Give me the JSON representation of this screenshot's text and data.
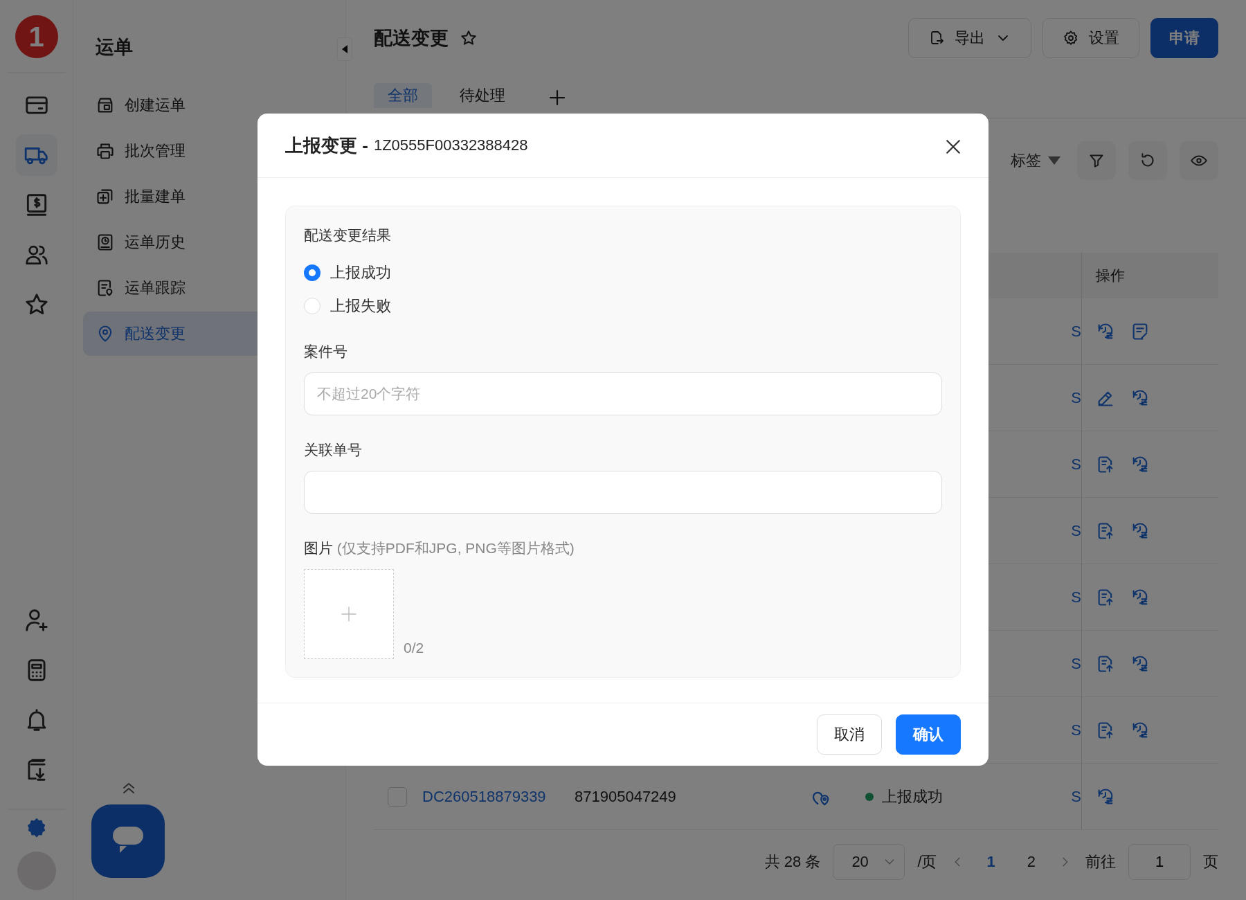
{
  "rail": {
    "logo": "1",
    "top": [
      {
        "kind": "card",
        "selected": false
      },
      {
        "kind": "truck",
        "selected": true
      },
      {
        "kind": "dollar-book",
        "selected": false
      },
      {
        "kind": "people",
        "selected": false
      },
      {
        "kind": "star",
        "selected": false
      }
    ],
    "bottom": [
      {
        "kind": "user-plus",
        "selected": false
      },
      {
        "kind": "calculator",
        "selected": false
      },
      {
        "kind": "bell",
        "selected": false
      },
      {
        "kind": "book-download",
        "selected": false
      }
    ]
  },
  "nav": {
    "title": "运单",
    "items": [
      {
        "label": "创建运单",
        "kind": "box",
        "selected": false
      },
      {
        "label": "批次管理",
        "kind": "printer",
        "selected": false
      },
      {
        "label": "批量建单",
        "kind": "copy-plus",
        "selected": false
      },
      {
        "label": "运单历史",
        "kind": "clock-document",
        "selected": false
      },
      {
        "label": "运单跟踪",
        "kind": "document-pin",
        "selected": false
      },
      {
        "label": "配送变更",
        "kind": "location-pin",
        "selected": true
      }
    ]
  },
  "header": {
    "title": "配送变更",
    "export": "导出",
    "settings": "设置",
    "apply": "申请"
  },
  "tabs": [
    {
      "label": "全部",
      "selected": true
    },
    {
      "label": "待处理",
      "selected": false
    }
  ],
  "toolbar": {
    "tag_filter": "标签"
  },
  "table": {
    "columns": {
      "actions": "操作"
    },
    "rows": [
      {
        "column_6": "S",
        "actions": [
          {
            "kind": "clock-list"
          },
          {
            "kind": "document-pen"
          }
        ]
      },
      {
        "column_6": "S",
        "actions": [
          {
            "kind": "pencil"
          },
          {
            "kind": "clock-list"
          }
        ]
      },
      {
        "column_6": "S",
        "actions": [
          {
            "kind": "document-arrow"
          },
          {
            "kind": "clock-list"
          }
        ]
      },
      {
        "column_6": "S",
        "actions": [
          {
            "kind": "document-arrow"
          },
          {
            "kind": "clock-list"
          }
        ]
      },
      {
        "column_6": "S",
        "actions": [
          {
            "kind": "document-arrow"
          },
          {
            "kind": "clock-list"
          }
        ]
      },
      {
        "column_6": "S",
        "actions": [
          {
            "kind": "document-arrow"
          },
          {
            "kind": "clock-list"
          }
        ]
      },
      {
        "column_6": "S",
        "actions": [
          {
            "kind": "document-arrow"
          },
          {
            "kind": "clock-list"
          }
        ]
      },
      {
        "checked": false,
        "order_no": "DC260518879339",
        "number": "871905047249",
        "status": "上报成功",
        "column_6": "S",
        "actions": [
          {
            "kind": "clock-list"
          }
        ]
      }
    ]
  },
  "pagination": {
    "total": "共 28 条",
    "page_size": "20",
    "per_page": "/页",
    "pages": [
      {
        "label": "1",
        "selected": true
      },
      {
        "label": "2",
        "selected": false
      }
    ],
    "goto": "前往",
    "goto_value": "1",
    "goto_suffix": "页"
  },
  "modal": {
    "title": "上报变更 -",
    "tracking_no": "1Z0555F00332388428",
    "result_label": "配送变更结果",
    "options": [
      {
        "label": "上报成功",
        "selected": true
      },
      {
        "label": "上报失败",
        "selected": false
      }
    ],
    "case_label": "案件号",
    "case_placeholder": "不超过20个字符",
    "ref_label": "关联单号",
    "image_label": "图片",
    "image_hint": "(仅支持PDF和JPG, PNG等图片格式)",
    "image_count": "0/2",
    "cancel": "取消",
    "confirm": "确认"
  }
}
